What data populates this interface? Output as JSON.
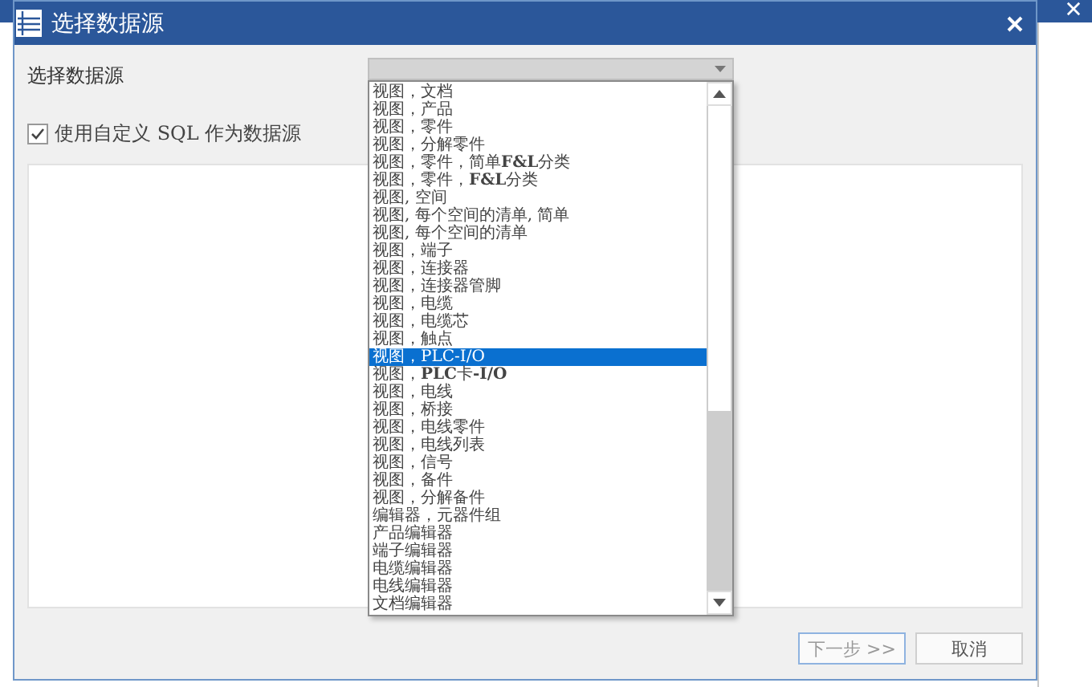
{
  "dialog": {
    "title": "选择数据源"
  },
  "source_label": "选择数据源",
  "dropdown": {
    "expanded": true,
    "options": [
      {
        "label": "视图，文档",
        "selected": false
      },
      {
        "label": "视图，产品",
        "selected": false
      },
      {
        "label": "视图，零件",
        "selected": false
      },
      {
        "label": "视图，分解零件",
        "selected": false
      },
      {
        "label": "视图，零件，简单**F&L**分类",
        "selected": false
      },
      {
        "label": "视图，零件，**F&L**分类",
        "selected": false
      },
      {
        "label": "视图, 空间",
        "selected": false
      },
      {
        "label": "视图, 每个空间的清单, 简单",
        "selected": false
      },
      {
        "label": "视图, 每个空间的清单",
        "selected": false
      },
      {
        "label": "视图，端子",
        "selected": false
      },
      {
        "label": "视图，连接器",
        "selected": false
      },
      {
        "label": "视图，连接器管脚",
        "selected": false
      },
      {
        "label": "视图，电缆",
        "selected": false
      },
      {
        "label": "视图，电缆芯",
        "selected": false
      },
      {
        "label": "视图，触点",
        "selected": false
      },
      {
        "label": "视图，PLC-I/O",
        "selected": true
      },
      {
        "label": "视图，**PLC**卡**-I/O**",
        "selected": false
      },
      {
        "label": "视图，电线",
        "selected": false
      },
      {
        "label": "视图，桥接",
        "selected": false
      },
      {
        "label": "视图，电线零件",
        "selected": false
      },
      {
        "label": "视图，电线列表",
        "selected": false
      },
      {
        "label": "视图，信号",
        "selected": false
      },
      {
        "label": "视图，备件",
        "selected": false
      },
      {
        "label": "视图，分解备件",
        "selected": false
      },
      {
        "label": "编辑器，元器件组",
        "selected": false
      },
      {
        "label": "产品编辑器",
        "selected": false
      },
      {
        "label": "端子编辑器",
        "selected": false
      },
      {
        "label": "电缆编辑器",
        "selected": false
      },
      {
        "label": "电线编辑器",
        "selected": false
      },
      {
        "label": "文档编辑器",
        "selected": false
      }
    ]
  },
  "custom_sql": {
    "label": "使用自定义 SQL 作为数据源",
    "checked": true
  },
  "buttons": [
    {
      "label": "下一步 >>",
      "kind": "primary",
      "disabled": true
    },
    {
      "label": "取消",
      "kind": "normal",
      "disabled": false
    }
  ]
}
